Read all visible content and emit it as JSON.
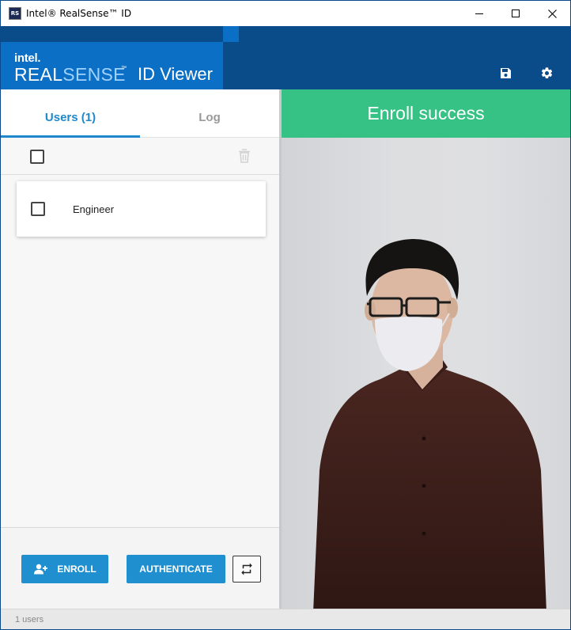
{
  "window": {
    "title": "Intel® RealSense™ ID",
    "icon_label": "RS"
  },
  "header": {
    "brand_small": "intel.",
    "brand_real": "REAL",
    "brand_sense": "SENSE",
    "brand_tm": "™",
    "app_name": "ID Viewer",
    "save_icon": "save-icon",
    "settings_icon": "gear-icon"
  },
  "tabs": [
    {
      "label": "Users (1)",
      "active": true
    },
    {
      "label": "Log",
      "active": false
    }
  ],
  "users": [
    {
      "name": "Engineer",
      "checked": false
    }
  ],
  "buttons": {
    "enroll": "ENROLL",
    "authenticate": "AUTHENTICATE"
  },
  "camera": {
    "status": "Enroll success",
    "status_color": "#35c284"
  },
  "statusbar": {
    "text": "1 users"
  },
  "colors": {
    "header_bg": "#0a4b8a",
    "logo_bg": "#0b6fc5",
    "accent": "#1f88cc",
    "button": "#1f8fd0"
  }
}
